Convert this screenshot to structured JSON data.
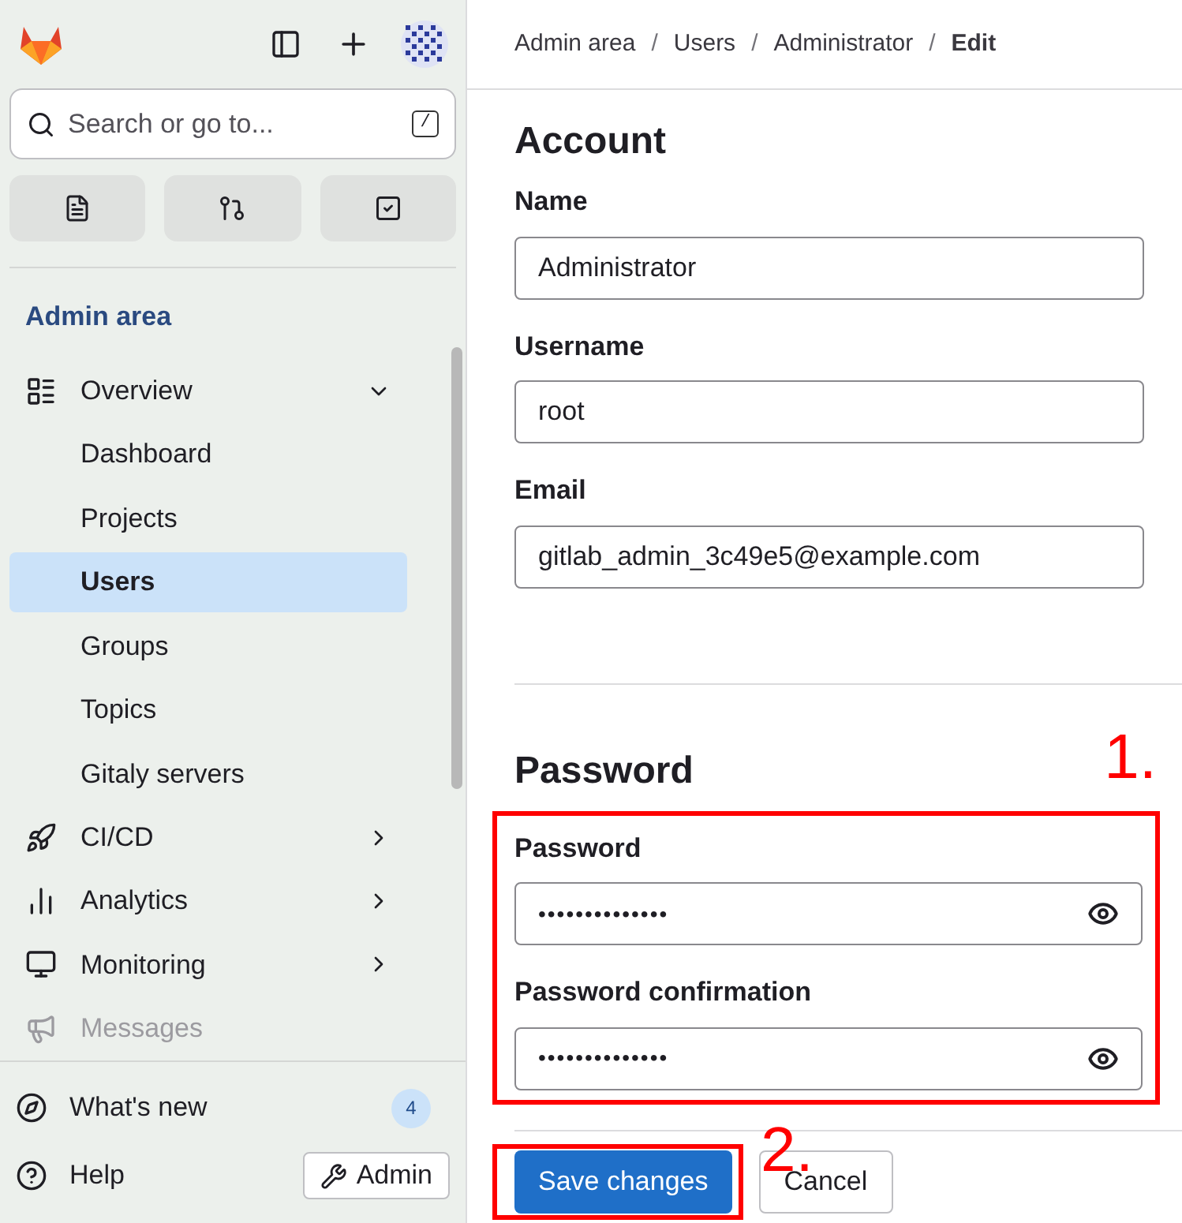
{
  "sidebar": {
    "search": {
      "placeholder": "Search or go to...",
      "shortcut": "/"
    },
    "section_title": "Admin area",
    "nav": [
      {
        "label": "Overview",
        "selected": false,
        "expanded": true,
        "faded": false,
        "children": [
          {
            "label": "Dashboard",
            "selected": false
          },
          {
            "label": "Projects",
            "selected": false
          },
          {
            "label": "Users",
            "selected": true
          },
          {
            "label": "Groups",
            "selected": false
          },
          {
            "label": "Topics",
            "selected": false
          },
          {
            "label": "Gitaly servers",
            "selected": false
          }
        ]
      },
      {
        "label": "CI/CD",
        "selected": false,
        "expanded": false,
        "faded": false
      },
      {
        "label": "Analytics",
        "selected": false,
        "expanded": false,
        "faded": false
      },
      {
        "label": "Monitoring",
        "selected": false,
        "expanded": false,
        "faded": false
      },
      {
        "label": "Messages",
        "selected": false,
        "expanded": false,
        "faded": true
      }
    ],
    "whats_new": {
      "label": "What's new",
      "count": "4"
    },
    "help": {
      "label": "Help"
    },
    "admin_button": {
      "label": "Admin"
    }
  },
  "main": {
    "breadcrumb": [
      {
        "label": "Admin area",
        "current": false
      },
      {
        "label": "Users",
        "current": false
      },
      {
        "label": "Administrator",
        "current": false
      },
      {
        "label": "Edit",
        "current": true
      }
    ],
    "breadcrumb_separator": "/",
    "sections": [
      {
        "title": "Account",
        "fields": [
          {
            "label": "Name",
            "value": "Administrator",
            "kind": "text"
          },
          {
            "label": "Username",
            "value": "root",
            "kind": "text"
          },
          {
            "label": "Email",
            "value": "gitlab_admin_3c49e5@example.com",
            "kind": "text"
          }
        ]
      },
      {
        "title": "Password",
        "fields": [
          {
            "label": "Password",
            "value": "••••••••••••••",
            "kind": "password"
          },
          {
            "label": "Password confirmation",
            "value": "••••••••••••••",
            "kind": "password"
          }
        ]
      }
    ],
    "buttons": [
      {
        "label": "Save changes",
        "kind": "primary"
      },
      {
        "label": "Cancel",
        "kind": "secondary"
      }
    ],
    "annotations": [
      {
        "label": "1."
      },
      {
        "label": "2."
      }
    ]
  }
}
